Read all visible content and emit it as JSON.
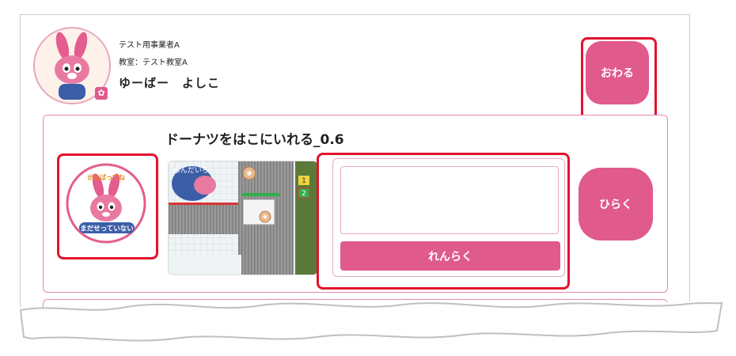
{
  "header": {
    "operator": "テスト用事業者A",
    "classroom": "教室：テスト教室A",
    "username": "ゆーばー　よしこ",
    "end_button": "おわる"
  },
  "lesson": {
    "title": "ドーナツをはこにいれる_0.6",
    "status_badge_top": "がんばってね",
    "status_badge_bottom": "まだせっていない",
    "thumbnail_label": "らんだいろ",
    "thumbnail_counter": [
      "1",
      "2"
    ],
    "message_placeholder": "",
    "send_button": "れんらく",
    "open_button": "ひらく"
  },
  "colors": {
    "accent": "#e05a8c",
    "highlight": "#e3122b",
    "card_border": "#e58aad"
  }
}
